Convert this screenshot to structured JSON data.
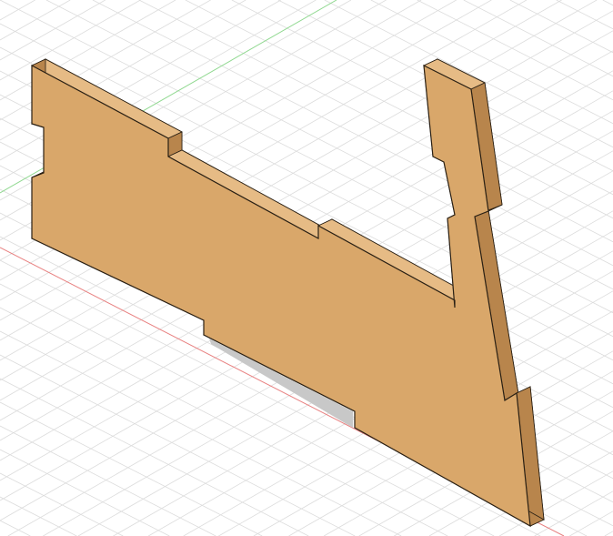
{
  "viewport": {
    "background": "#ffffff",
    "grid_color": "#dcdcdc",
    "x_axis_color": "#e88080",
    "y_axis_color": "#8fd88f"
  },
  "part": {
    "face_color": "#d9a76a",
    "side_color": "#b8854c",
    "top_color": "#e6bb85",
    "edge_color": "#2a2014",
    "shadow_color": "#c8c8c8"
  }
}
